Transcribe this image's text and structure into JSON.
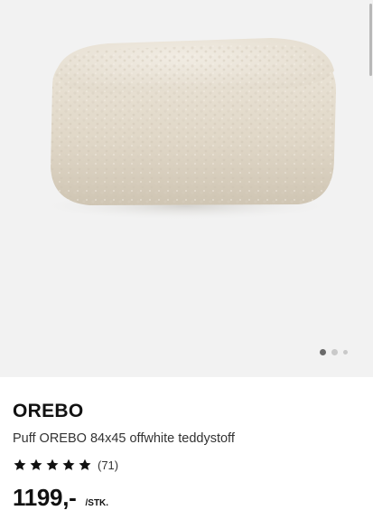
{
  "product": {
    "name": "OREBO",
    "description": "Puff OREBO 84x45 offwhite teddystoff",
    "rating": {
      "stars": 5,
      "count_label": "(71)"
    },
    "price": "1199,-",
    "unit": "/STK."
  },
  "gallery": {
    "image_icon": "pouf-product-photo",
    "dots": {
      "total": 3,
      "active_index": 0
    }
  },
  "colors": {
    "gallery_bg": "#f2f2f2",
    "pouf_fabric": "#e8e1d4",
    "text_primary": "#111111"
  }
}
